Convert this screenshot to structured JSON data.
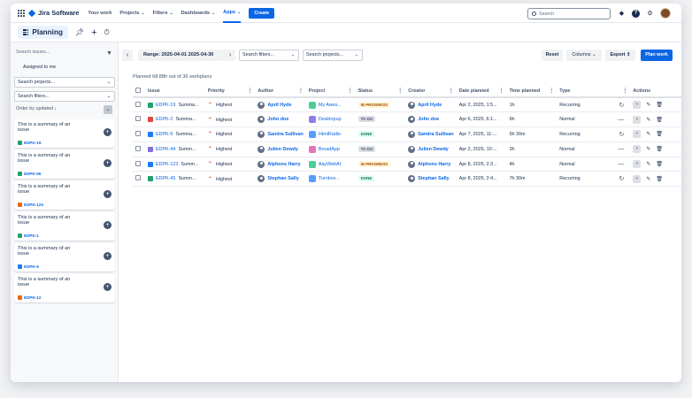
{
  "nav": {
    "brand": "Jira Software",
    "items": [
      "Your work",
      "Projects",
      "Filters",
      "Dashboards",
      "Apps"
    ],
    "create_label": "Create",
    "search_placeholder": "Search"
  },
  "header": {
    "title": "Planning"
  },
  "sidebar": {
    "search_placeholder": "Search issues...",
    "assigned_label": "Assigned to me",
    "projects_placeholder": "Search projects...",
    "filters_placeholder": "Search filters...",
    "order_label": "Order by updated",
    "cards": [
      {
        "summary": "This is a summary of an issue",
        "key": "EDPK-19",
        "type_color": "#22a06b"
      },
      {
        "summary": "This is a summary of an issue",
        "key": "EDPK-96",
        "type_color": "#22a06b"
      },
      {
        "summary": "This is a summary of an issue",
        "key": "EDPK-123",
        "type_color": "#e56910"
      },
      {
        "summary": "This is a summary of an issue",
        "key": "EDPK-1",
        "type_color": "#22a06b"
      },
      {
        "summary": "This is a summary of an issue",
        "key": "EDPK-5",
        "type_color": "#1d7afc"
      },
      {
        "summary": "This is a summary of an issue",
        "key": "EDPK-12",
        "type_color": "#e56910"
      }
    ]
  },
  "toolbar": {
    "range_label": "Range: 2025-04-01 2025-04-30",
    "filters_placeholder": "Search filters...",
    "projects_placeholder": "Search projects...",
    "reset_label": "Reset",
    "columns_label": "Columns",
    "export_label": "Export",
    "plan_work_label": "Plan work"
  },
  "planned_text": "Planned 68.88h out of 36 workplans",
  "table": {
    "headers": [
      "Issue",
      "Priority",
      "Author",
      "Project",
      "Status",
      "Creator",
      "Date planned",
      "Time planned",
      "Type",
      "Actions"
    ],
    "rows": [
      {
        "key": "EDPK-19",
        "summary": "Summa...",
        "type_color": "#22a06b",
        "priority": "Highest",
        "author": "April Hyde",
        "project": "My Awes...",
        "project_color": "#4bce97",
        "status": "IN PROGRESS",
        "status_kind": "prog",
        "creator": "April Hyde",
        "date": "Apr 2, 2025, 1:5...",
        "time": "1h",
        "type": "Recurring"
      },
      {
        "key": "EDPK-2",
        "summary": "Summa...",
        "type_color": "#e2483d",
        "priority": "Highest",
        "author": "John doe",
        "project": "Desktopup",
        "project_color": "#8f7ee7",
        "status": "TO DO",
        "status_kind": "todo",
        "creator": "John doe",
        "date": "Apr 6, 2025, 6:1...",
        "time": "6h",
        "type": "Normal"
      },
      {
        "key": "EDPK-5",
        "summary": "Summa...",
        "type_color": "#1d7afc",
        "priority": "Highest",
        "author": "Sandra Sullivan",
        "project": "HtmlRadio",
        "project_color": "#579dff",
        "status": "DONE",
        "status_kind": "done",
        "creator": "Sandra Sullivan",
        "date": "Apr 7, 2025, 11:...",
        "time": "5h 30m",
        "type": "Recurring"
      },
      {
        "key": "EDPK-44",
        "summary": "Summ...",
        "type_color": "#8270db",
        "priority": "Highest",
        "author": "Julien Dewdy",
        "project": "BroadApp",
        "project_color": "#e774bb",
        "status": "TO DO",
        "status_kind": "todo",
        "creator": "Julien Dewdy",
        "date": "Apr 2, 2025, 10:...",
        "time": "2h",
        "type": "Normal"
      },
      {
        "key": "EDPK-123",
        "summary": "Summ...",
        "type_color": "#1d7afc",
        "priority": "Highest",
        "author": "Alphons Harry",
        "project": "AayWebAI",
        "project_color": "#4bce97",
        "status": "IN PROGRESS",
        "status_kind": "prog",
        "creator": "Alphons Harry",
        "date": "Apr 8, 2025, 2:3...",
        "time": "4h",
        "type": "Normal"
      },
      {
        "key": "EDPK-45",
        "summary": "Summ...",
        "type_color": "#22a06b",
        "priority": "Highest",
        "author": "Stephan Sally",
        "project": "Turnbov...",
        "project_color": "#579dff",
        "status": "DONE",
        "status_kind": "done",
        "creator": "Stephan Sally",
        "date": "Apr 8, 2025, 2:4...",
        "time": "7h 30m",
        "type": "Recurring"
      }
    ]
  }
}
